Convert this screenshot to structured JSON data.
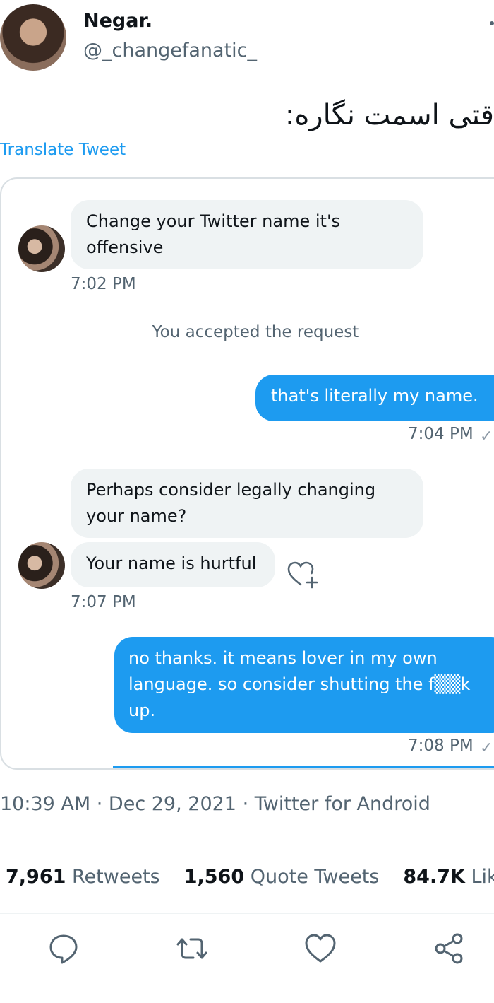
{
  "header": {
    "display_name": "Negar.",
    "handle": "@_changefanatic_"
  },
  "tweet": {
    "text": "قتی اسمت نگاره:",
    "translate_label": "Translate Tweet"
  },
  "dm": {
    "messages": [
      {
        "text": "Change your Twitter name it's offensive",
        "time": "7:02 PM"
      },
      {
        "system": "You accepted the request"
      },
      {
        "text": "that's literally my name.",
        "time": "7:04 PM"
      },
      {
        "text": "Perhaps consider legally changing your name?"
      },
      {
        "text": "Your name is hurtful",
        "time": "7:07 PM"
      },
      {
        "text": "no thanks. it means lover in my own language. so consider shutting the f▒▒k up.",
        "time": "7:08 PM"
      }
    ],
    "check_mark": "✓",
    "react_icon": "heart-plus-icon"
  },
  "meta": {
    "time": "10:39 AM",
    "date": "Dec 29, 2021",
    "source": "Twitter for Android",
    "separator": " · "
  },
  "stats": {
    "retweets_count": "7,961",
    "retweets_label": "Retweets",
    "quotes_count": "1,560",
    "quotes_label": "Quote Tweets",
    "likes_count": "84.7K",
    "likes_label": "Likes"
  },
  "actions": [
    "reply-icon",
    "retweet-icon",
    "like-icon",
    "share-icon"
  ],
  "colors": {
    "accent": "#1d9bf0",
    "bubble_in": "#eff3f4",
    "muted": "#536471"
  }
}
